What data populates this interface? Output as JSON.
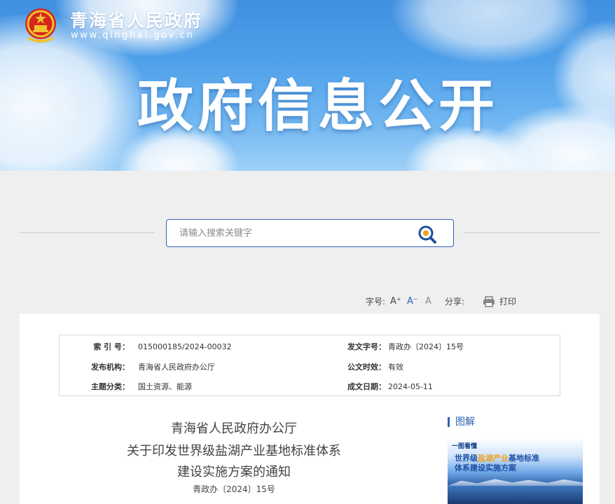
{
  "header": {
    "site_name": "青海省人民政府",
    "site_url": "www.qinghai.gov.cn",
    "banner_title": "政府信息公开"
  },
  "search": {
    "placeholder": "请输入搜索关键字"
  },
  "toolbar": {
    "font_size_label": "字号:",
    "font_large": "A⁺",
    "font_small": "A⁻",
    "font_normal": "A",
    "share_label": "分享:",
    "print_label": "打印"
  },
  "meta": {
    "index_label": "索 引 号：",
    "index_value": "015000185/2024-00032",
    "doc_no_label": "发文字号：",
    "doc_no_value": "青政办〔2024〕15号",
    "issuer_label": "发布机构：",
    "issuer_value": "青海省人民政府办公厅",
    "validity_label": "公文时效：",
    "validity_value": "有效",
    "topic_label": "主题分类：",
    "topic_value": "国土资源、能源",
    "date_label": "成文日期：",
    "date_value": "2024-05-11"
  },
  "document": {
    "title_line1": "青海省人民政府办公厅",
    "title_line2": "关于印发世界级盐湖产业基地标准体系",
    "title_line3": "建设实施方案的通知",
    "doc_number": "青政办〔2024〕15号"
  },
  "sidebar": {
    "section_title": "图解",
    "card_tag": "一图看懂",
    "card_title_part1": "世界级",
    "card_title_highlight": "盐湖产业",
    "card_title_part2": "基地标准",
    "card_title_line2": "体系建设实施方案"
  },
  "colors": {
    "accent": "#2a63b4",
    "highlight": "#f0a21c"
  }
}
